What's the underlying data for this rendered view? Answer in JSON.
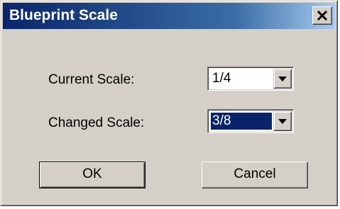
{
  "window": {
    "title": "Blueprint Scale",
    "close_icon": "close-icon"
  },
  "form": {
    "current_scale_label": "Current Scale:",
    "current_scale_value": "1/4",
    "changed_scale_label": "Changed Scale:",
    "changed_scale_value": "3/8"
  },
  "buttons": {
    "ok_label": "OK",
    "cancel_label": "Cancel"
  },
  "colors": {
    "title_gradient_start": "#0a246a",
    "title_gradient_end": "#a6caf0",
    "dialog_face": "#d4d0c8",
    "selection": "#0a246a"
  }
}
